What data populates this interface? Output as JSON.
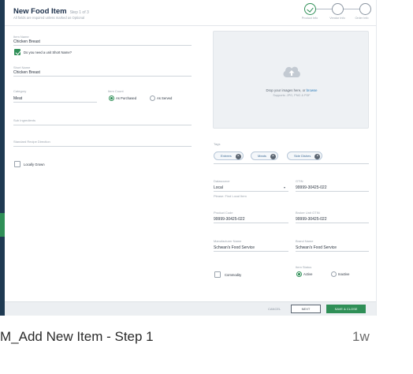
{
  "header": {
    "title": "New Food Item",
    "step": "Step 1 of 3",
    "subtitle": "All fields are required unless marked as Optional",
    "steps": [
      {
        "label": "Product Info",
        "status": "done"
      },
      {
        "label": "Vendor Info",
        "status": "pending"
      },
      {
        "label": "Order Info",
        "status": "pending"
      }
    ]
  },
  "left": {
    "item_name_label": "Item Name",
    "item_name_value": "Chicken Breast",
    "short_name_check": "Do you need a unit Short Name?",
    "short_name_label": "Short Name",
    "short_name_value": "Chicken Breast",
    "category_label": "Category",
    "category_value": "Meat",
    "item_count_label": "Item Count",
    "radio_purchased": "As Purchased",
    "radio_served": "As Served",
    "sub_ingredients_label": "Sub Ingredients",
    "standard_recipe_label": "Standard Recipe Direction",
    "locally_grown": "Locally Grown"
  },
  "upload": {
    "line1_prefix": "Drop your images here, or",
    "link": "browse",
    "line2": "Supports: JPG, PNG & PDF"
  },
  "right": {
    "tags_label": "Tags",
    "tags": [
      "Entrees",
      "Meats",
      "Side Dishes"
    ],
    "datasource_label": "Datasource",
    "datasource_value": "Local",
    "datasource_help": "Please: Find Local Item",
    "gtin_label": "GTIN",
    "gtin_value": "99999-30425-022",
    "product_code_label": "Product Code",
    "product_code_value": "99999-30425-022",
    "bu_gtin_label": "Broker Unit GTIN",
    "bu_gtin_value": "99999-30425-022",
    "manufacturer_label": "Manufacturer Name",
    "manufacturer_value": "Schwan's Food Service",
    "brand_label": "Brand Name",
    "brand_value": "Schwan's Food Service",
    "commodity": "Commodity",
    "item_status_label": "Item Status",
    "status_active": "Active",
    "status_inactive": "Inactive"
  },
  "footer": {
    "cancel": "CANCEL",
    "next": "NEXT",
    "save_close": "SAVE & CLOSE"
  },
  "caption": {
    "title": "M_Add New Item - Step 1",
    "age": "1w"
  },
  "colors": {
    "primary_green": "#2f8f57",
    "navy": "#1b2f4a",
    "link_blue": "#2a7ab8"
  }
}
